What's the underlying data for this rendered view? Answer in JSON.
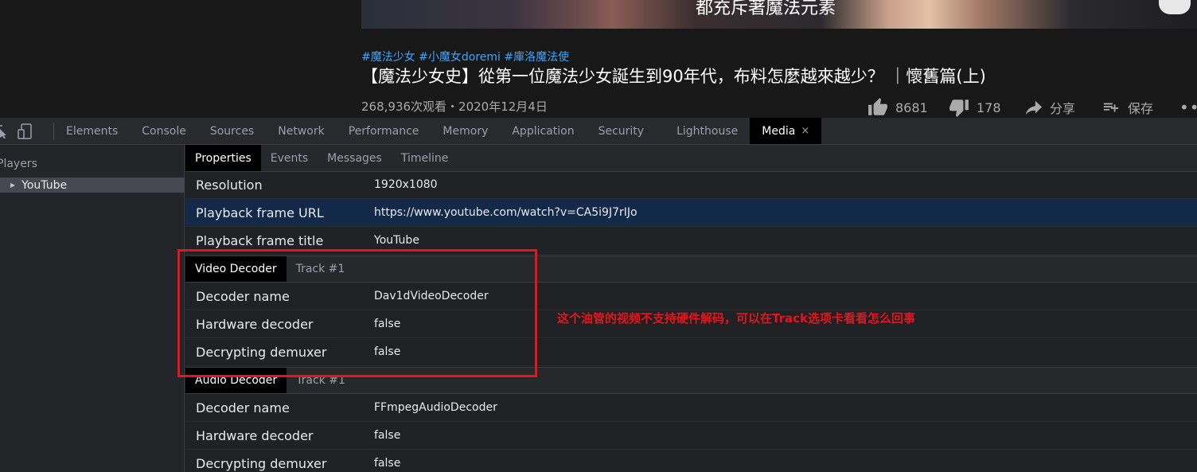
{
  "youtube": {
    "subtitle": "都充斥著魔法元素",
    "hashtags": "#魔法少女 #小魔女doremi #庫洛魔法使",
    "title": "【魔法少女史】從第一位魔法少女誕生到90年代，布料怎麼越來越少？ ｜懷舊篇(上)",
    "meta": "268,936次观看・2020年12月4日",
    "actions": {
      "like_count": "8681",
      "dislike_count": "178",
      "share_label": "分享",
      "save_label": "保存"
    }
  },
  "devtools": {
    "tabs": [
      "Elements",
      "Console",
      "Sources",
      "Network",
      "Performance",
      "Memory",
      "Application",
      "Security",
      "Lighthouse"
    ],
    "active_tab": "Media",
    "close_glyph": "×"
  },
  "media": {
    "players_heading": "Players",
    "players": [
      "YouTube"
    ],
    "subtabs": [
      "Properties",
      "Events",
      "Messages",
      "Timeline"
    ],
    "properties": [
      {
        "key": "Resolution",
        "value": "1920x1080"
      },
      {
        "key": "Playback frame URL",
        "value": "https://www.youtube.com/watch?v=CA5i9J7rIJo"
      },
      {
        "key": "Playback frame title",
        "value": "YouTube"
      }
    ],
    "video_decoder": {
      "tabs": [
        "Video Decoder",
        "Track #1"
      ],
      "rows": [
        {
          "key": "Decoder name",
          "value": "Dav1dVideoDecoder"
        },
        {
          "key": "Hardware decoder",
          "value": "false"
        },
        {
          "key": "Decrypting demuxer",
          "value": "false"
        }
      ]
    },
    "audio_decoder": {
      "tabs": [
        "Audio Decoder",
        "Track #1"
      ],
      "rows": [
        {
          "key": "Decoder name",
          "value": "FFmpegAudioDecoder"
        },
        {
          "key": "Hardware decoder",
          "value": "false"
        },
        {
          "key": "Decrypting demuxer",
          "value": "false"
        }
      ]
    }
  },
  "annotation": {
    "text": "这个油管的视频不支持硬件解码，可以在Track选项卡看看怎么回事",
    "color": "#e8141c"
  },
  "colors": {
    "selected_row": "#12294a",
    "link_blue": "#3ea6ff"
  }
}
